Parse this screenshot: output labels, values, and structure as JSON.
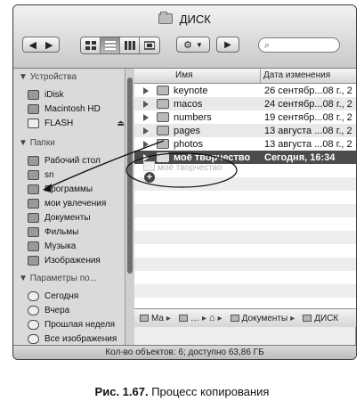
{
  "window": {
    "title": "ДИСК",
    "status_text": "Кол-во объектов: 6; доступно 63,86 ГБ"
  },
  "toolbar": {
    "back_icon": "chevron-left-icon",
    "forward_icon": "chevron-right-icon",
    "view_modes": [
      "icons-view-icon",
      "list-view-icon",
      "columns-view-icon",
      "coverflow-view-icon"
    ],
    "active_view": "list-view-icon",
    "action_icon": "gear-icon",
    "quicklook_icon": "eye-icon",
    "search_placeholder": ""
  },
  "sidebar": {
    "sections": [
      {
        "title": "Устройства",
        "items": [
          {
            "label": "iDisk",
            "icon": "idisk-icon"
          },
          {
            "label": "Macintosh HD",
            "icon": "hard-drive-icon"
          },
          {
            "label": "FLASH",
            "icon": "flash-drive-icon",
            "eject": "⏏"
          }
        ]
      },
      {
        "title": "Папки",
        "items": [
          {
            "label": "Рабочий стол",
            "icon": "desktop-icon"
          },
          {
            "label": "sn",
            "icon": "home-icon"
          },
          {
            "label": "Программы",
            "icon": "applications-icon"
          },
          {
            "label": "мои увлечения",
            "icon": "folder-icon"
          },
          {
            "label": "Документы",
            "icon": "folder-icon"
          },
          {
            "label": "Фильмы",
            "icon": "movies-icon"
          },
          {
            "label": "Музыка",
            "icon": "music-icon"
          },
          {
            "label": "Изображения",
            "icon": "pictures-icon"
          }
        ]
      },
      {
        "title": "Параметры по...",
        "items": [
          {
            "label": "Сегодня",
            "icon": "clock-icon"
          },
          {
            "label": "Вчера",
            "icon": "clock-icon"
          },
          {
            "label": "Прошлая неделя",
            "icon": "clock-icon"
          },
          {
            "label": "Все изображения",
            "icon": "clock-icon"
          }
        ]
      }
    ]
  },
  "list": {
    "columns": {
      "name": "Имя",
      "date": "Дата изменения"
    },
    "rows": [
      {
        "name": "keynote",
        "date": "26 сентябр...08 г., 2"
      },
      {
        "name": "macos",
        "date": "24 сентябр...08 г., 2"
      },
      {
        "name": "numbers",
        "date": "19 сентябр...08 г., 2"
      },
      {
        "name": "pages",
        "date": "13 августа ...08 г., 2"
      },
      {
        "name": "photos",
        "date": "13 августа ...08 г., 2"
      },
      {
        "name": "моё творчество",
        "date": "Сегодня, 16:34",
        "selected": true
      }
    ]
  },
  "drag": {
    "ghost_label": "моё творчество",
    "copy_badge": "+"
  },
  "pathbar": {
    "items": [
      "Ma",
      "Документы",
      "ДИСК"
    ]
  },
  "caption": {
    "label": "Рис. 1.67.",
    "text": " Процесс копирования"
  },
  "colors": {
    "selected_row": "#4c4c4c",
    "sidebar_bg": "#dadada"
  }
}
